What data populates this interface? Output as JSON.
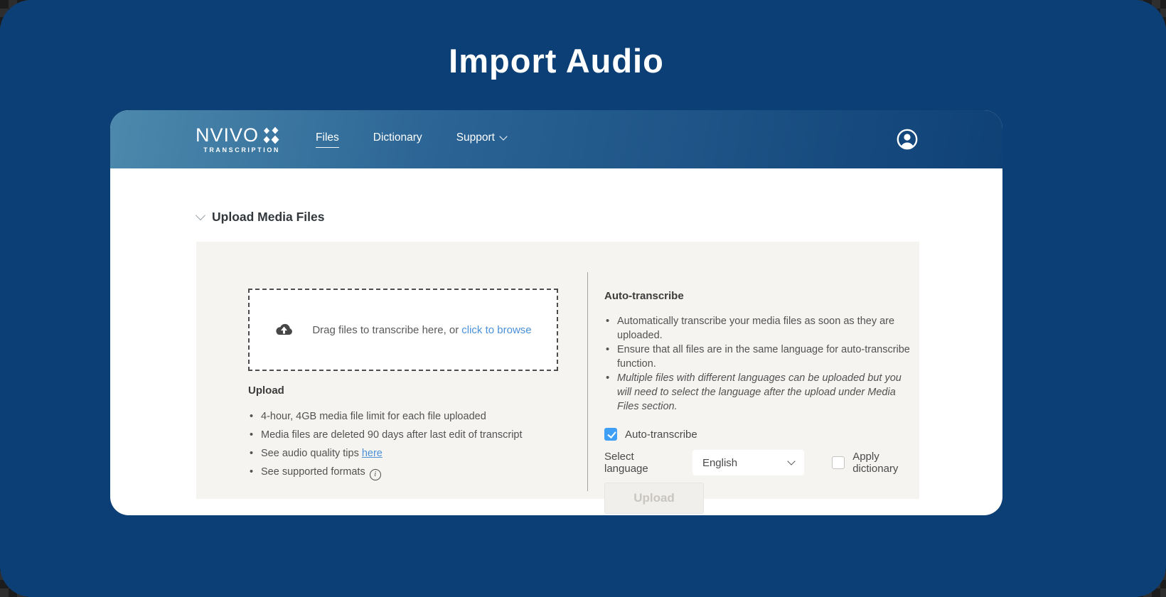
{
  "page": {
    "title": "Import Audio"
  },
  "navbar": {
    "brand": {
      "name": "NVIVO",
      "sub": "TRANSCRIPTION",
      "logo_icon": "sparkle-diamonds-icon"
    },
    "items": [
      {
        "label": "Files",
        "active": true
      },
      {
        "label": "Dictionary",
        "active": false
      },
      {
        "label": "Support",
        "active": false,
        "has_dropdown": true
      }
    ],
    "avatar_icon": "user-avatar-icon"
  },
  "section": {
    "title": "Upload Media Files",
    "collapse_icon": "chevron-down-icon"
  },
  "dropzone": {
    "icon": "cloud-upload-icon",
    "text": "Drag files to transcribe here, or",
    "link": "click to browse"
  },
  "upload_info": {
    "heading": "Upload",
    "bullets": [
      {
        "text": "4-hour, 4GB media file limit for each file uploaded"
      },
      {
        "text": "Media files are deleted 90 days after last edit of transcript"
      },
      {
        "text": "See audio quality tips",
        "link": "here"
      },
      {
        "text": "See supported formats",
        "icon": "info-icon"
      }
    ]
  },
  "auto_transcribe": {
    "heading": "Auto-transcribe",
    "bullets": [
      {
        "text": "Automatically transcribe your media files as soon as they are uploaded.",
        "italic": false
      },
      {
        "text": "Ensure that all files are in the same language for auto-transcribe function.",
        "italic": false
      },
      {
        "text": "Multiple files with different languages can be uploaded but you will need to select the language after the upload under Media Files section.",
        "italic": true
      }
    ],
    "checkbox": {
      "label": "Auto-transcribe",
      "checked": true
    },
    "language": {
      "label": "Select language",
      "value": "English"
    },
    "apply_dictionary": {
      "label": "Apply dictionary",
      "checked": false
    },
    "upload_button": {
      "label": "Upload",
      "disabled": true
    }
  },
  "colors": {
    "canvas_blue": "#0c3f75",
    "header_gradient_left": "#4c89ac",
    "header_gradient_right": "#0f4176",
    "panel_bg": "#f5f4f1",
    "link_blue": "#4a90d9",
    "checkbox_blue": "#3f9ff6",
    "disabled_button_bg": "#f0efeb",
    "disabled_button_text": "#c9c6c2"
  }
}
